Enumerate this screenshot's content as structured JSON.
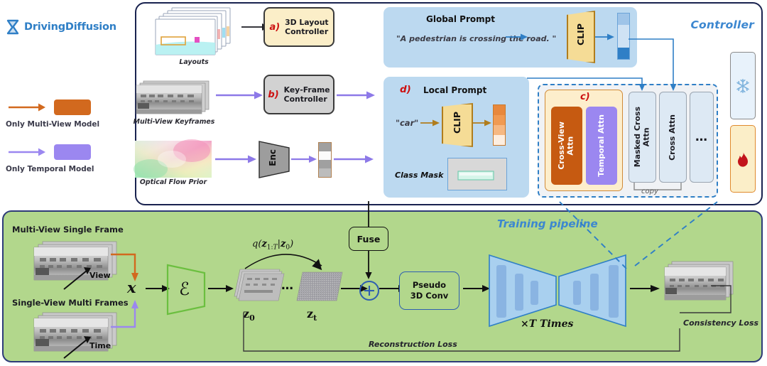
{
  "logo": {
    "name": "DrivingDiffusion",
    "icon": "hourglass-logo-icon",
    "color": "#2f7fc6"
  },
  "legend": {
    "items": [
      {
        "label": "Only Multi-View Model",
        "color": "#d2691e",
        "icon": "arrow-right-icon"
      },
      {
        "label": "Only Temporal Model",
        "color": "#9b87f0",
        "icon": "arrow-right-icon"
      }
    ]
  },
  "controller": {
    "title": "Controller",
    "inputs": [
      {
        "caption": "Layouts",
        "thumb": "layout-stack-thumbnail"
      },
      {
        "caption": "Multi-View Keyframes",
        "thumb": "keyframe-stack-thumbnail"
      },
      {
        "caption": "Optical Flow Prior",
        "thumb": "optical-flow-thumbnail"
      }
    ],
    "blocks": [
      {
        "tag": "a)",
        "label": "3D Layout\nController",
        "line1": "3D Layout",
        "line2": "Controller",
        "fill": "#fbeec8",
        "border": "#3a3a3a"
      },
      {
        "tag": "b)",
        "label": "Key-Frame\nController",
        "line1": "Key-Frame",
        "line2": "Controller",
        "fill": "#d2d2d2",
        "border": "#3a3a3a"
      }
    ],
    "encoder": {
      "label": "Enc"
    },
    "global_prompt": {
      "title": "Global Prompt",
      "text": "\"A pedestrian is crossing the road. \"",
      "clip": "CLIP"
    },
    "local_prompt": {
      "tag": "d)",
      "title": "Local Prompt",
      "text": "\"car\"",
      "clip": "CLIP",
      "mask_label": "Class Mask"
    },
    "attention": {
      "tag": "c)",
      "inner": [
        {
          "label": "Cross-View\nAttn",
          "line1": "Cross-View",
          "line2": "Attn",
          "fill": "#c65a11",
          "text": "#ffffff"
        },
        {
          "label": "Temporal Attn",
          "line1": "Temporal Attn",
          "line2": "",
          "fill": "#9b87f0",
          "text": "#ffffff"
        }
      ],
      "outer": [
        {
          "line1": "Masked Cross",
          "line2": "Attn"
        },
        {
          "line1": "Cross Attn",
          "line2": ""
        },
        {
          "line1": "…",
          "line2": ""
        }
      ],
      "copy_label": "copy"
    },
    "status_icons": [
      {
        "name": "snowflake-frozen-icon",
        "fill": "#e8f2fb",
        "border": "#8a8a8a",
        "glyph": "❄"
      },
      {
        "name": "fire-trainable-icon",
        "fill": "#fbeec8",
        "border": "#e08a2e",
        "glyph": "🔥"
      }
    ]
  },
  "training": {
    "title": "Training pipeline",
    "input_rows": [
      {
        "caption": "Multi-View Single Frame",
        "arrow_label": "View",
        "arrow_color": "#d2691e"
      },
      {
        "caption": "Single-View Multi Frames",
        "arrow_label": "Time",
        "arrow_color": "#9b87f0"
      }
    ],
    "x_symbol": "𝒙",
    "encoder_symbol": "ℰ",
    "latent_start": "z",
    "latent_start_sub": "0",
    "latent_noisy": "z",
    "latent_noisy_sub": "t",
    "ellipsis": "…",
    "diffusion_label": "q(z",
    "diffusion_label_full": "q(z1:T|z0)",
    "fuse_label": "Fuse",
    "plus_symbol": "⊕",
    "conv_line1": "Pseudo",
    "conv_line2": "3D Conv",
    "unet_label": "×T Times",
    "consistency_loss": "Consistency Loss",
    "reconstruction_loss": "Reconstruction Loss"
  }
}
